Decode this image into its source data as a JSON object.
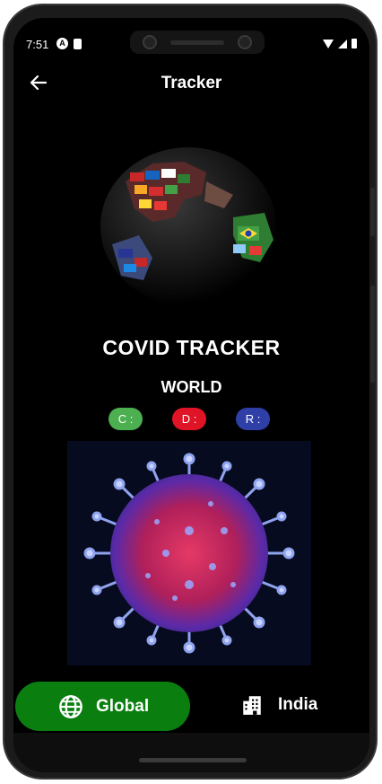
{
  "status_bar": {
    "time": "7:51"
  },
  "app_bar": {
    "title": "Tracker"
  },
  "main": {
    "headline": "COVID TRACKER",
    "region": "WORLD",
    "chips": [
      {
        "label": "C :",
        "color": "#4caf50"
      },
      {
        "label": "D :",
        "color": "#e01427"
      },
      {
        "label": "R :",
        "color": "#2f3fa8"
      }
    ]
  },
  "bottom_nav": {
    "items": [
      {
        "label": "Global",
        "icon": "globe-icon",
        "active": true,
        "active_color": "#0a7f10"
      },
      {
        "label": "India",
        "icon": "building-icon",
        "active": false
      }
    ]
  }
}
